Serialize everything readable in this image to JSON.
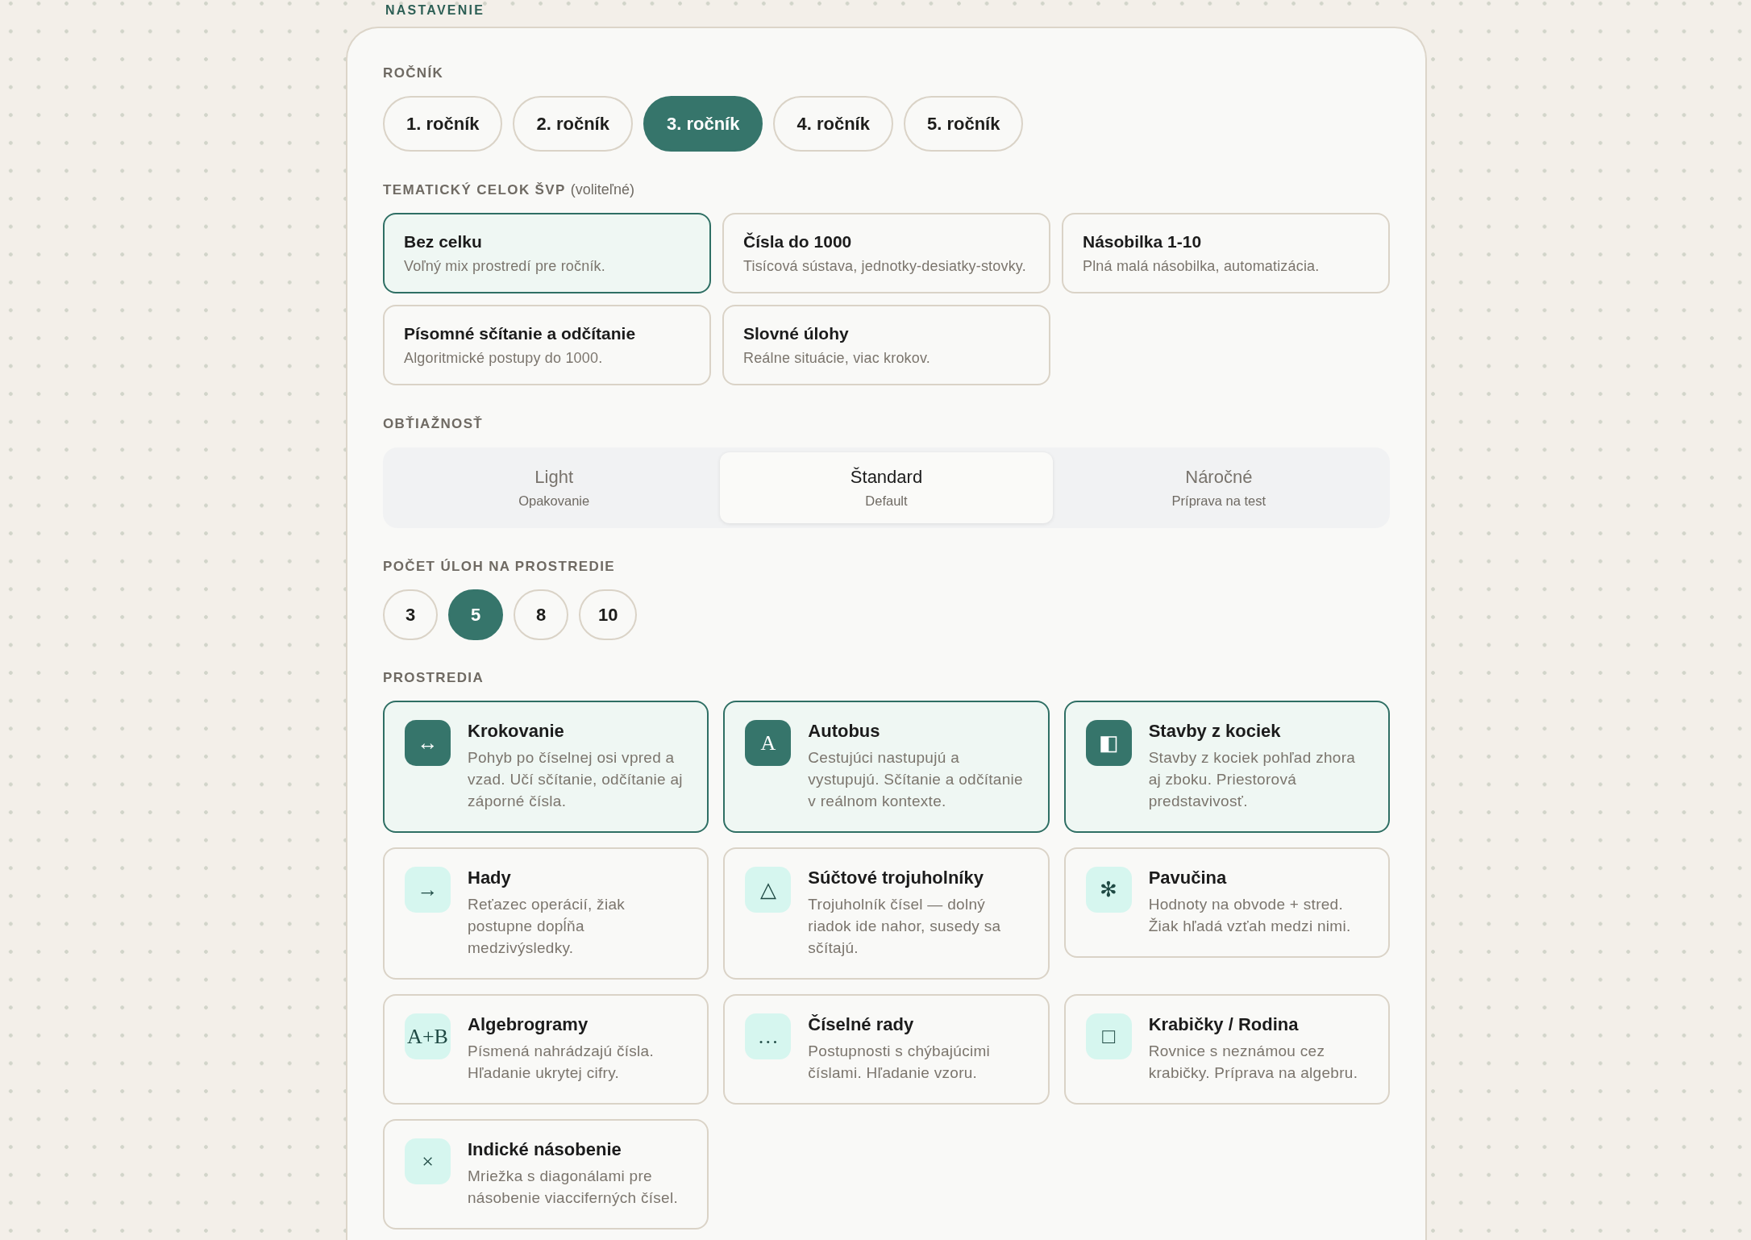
{
  "heading": "NASTAVENIE",
  "grade": {
    "label": "ROČNÍK",
    "options": [
      {
        "label": "1. ročník",
        "selected": false
      },
      {
        "label": "2. ročník",
        "selected": false
      },
      {
        "label": "3. ročník",
        "selected": true
      },
      {
        "label": "4. ročník",
        "selected": false
      },
      {
        "label": "5. ročník",
        "selected": false
      }
    ]
  },
  "topic": {
    "label": "TEMATICKÝ CELOK ŠVP",
    "hint": "(voliteľné)",
    "options": [
      {
        "title": "Bez celku",
        "description": "Voľný mix prostredí pre ročník.",
        "selected": true
      },
      {
        "title": "Čísla do 1000",
        "description": "Tisícová sústava, jednotky-desiatky-stovky.",
        "selected": false
      },
      {
        "title": "Násobilka 1-10",
        "description": "Plná malá násobilka, automatizácia.",
        "selected": false
      },
      {
        "title": "Písomné sčítanie a odčítanie",
        "description": "Algoritmické postupy do 1000.",
        "selected": false
      },
      {
        "title": "Slovné úlohy",
        "description": "Reálne situácie, viac krokov.",
        "selected": false
      }
    ]
  },
  "difficulty": {
    "label": "OBŤIAŽNOSŤ",
    "options": [
      {
        "title": "Light",
        "subtitle": "Opakovanie",
        "selected": false
      },
      {
        "title": "Štandard",
        "subtitle": "Default",
        "selected": true
      },
      {
        "title": "Náročné",
        "subtitle": "Príprava na test",
        "selected": false
      }
    ]
  },
  "task_count": {
    "label": "POČET ÚLOH NA PROSTREDIE",
    "options": [
      {
        "value": "3",
        "selected": false
      },
      {
        "value": "5",
        "selected": true
      },
      {
        "value": "8",
        "selected": false
      },
      {
        "value": "10",
        "selected": false
      }
    ]
  },
  "environments": {
    "label": "PROSTREDIA",
    "items": [
      {
        "icon": "↔",
        "title": "Krokovanie",
        "description": "Pohyb po číselnej osi vpred a vzad. Učí sčítanie, odčítanie aj záporné čísla.",
        "selected": true
      },
      {
        "icon": "A",
        "title": "Autobus",
        "description": "Cestujúci nastupujú a vystupujú. Sčítanie a odčítanie v reálnom kontexte.",
        "selected": true
      },
      {
        "icon": "◧",
        "title": "Stavby z kociek",
        "description": "Stavby z kociek pohľad zhora aj zboku. Priestorová predstavivosť.",
        "selected": true
      },
      {
        "icon": "→",
        "title": "Hady",
        "description": "Reťazec operácií, žiak postupne dopĺňa medzivýsledky.",
        "selected": false
      },
      {
        "icon": "△",
        "title": "Súčtové trojuholníky",
        "description": "Trojuholník čísel — dolný riadok ide nahor, susedy sa sčítajú.",
        "selected": false
      },
      {
        "icon": "✻",
        "title": "Pavučina",
        "description": "Hodnoty na obvode + stred. Žiak hľadá vzťah medzi nimi.",
        "selected": false
      },
      {
        "icon": "A+B",
        "title": "Algebrogramy",
        "description": "Písmená nahrádzajú čísla. Hľadanie ukrytej cifry.",
        "selected": false
      },
      {
        "icon": "…",
        "title": "Číselné rady",
        "description": "Postupnosti s chýbajúcimi číslami. Hľadanie vzoru.",
        "selected": false
      },
      {
        "icon": "□",
        "title": "Krabičky / Rodina",
        "description": "Rovnice s neznámou cez krabičky. Príprava na algebru.",
        "selected": false
      },
      {
        "icon": "×",
        "title": "Indické násobenie",
        "description": "Mriežka s diagonálami pre násobenie viacciferných čísel.",
        "selected": false
      }
    ]
  }
}
